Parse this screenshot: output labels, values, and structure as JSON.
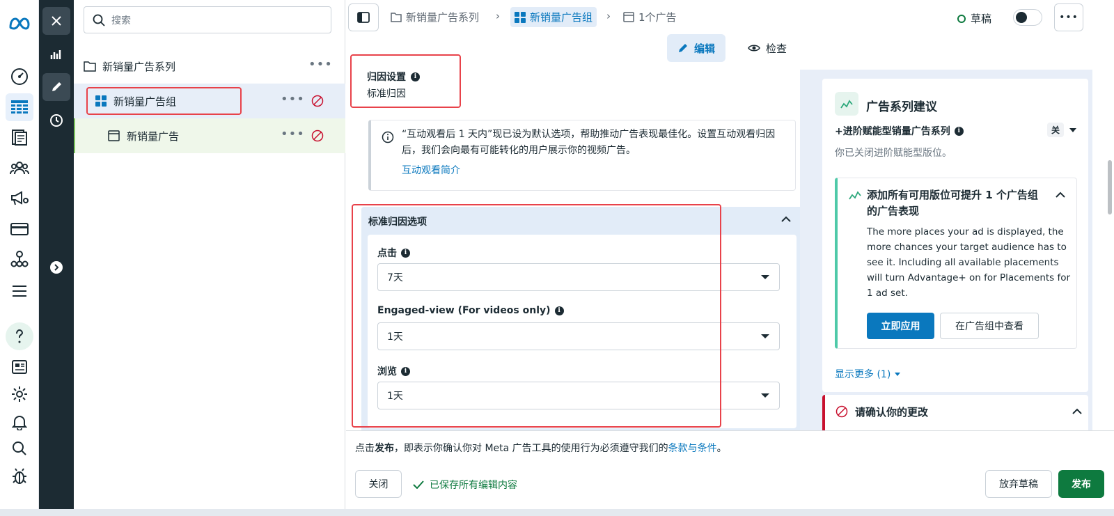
{
  "search": {
    "placeholder": "搜索"
  },
  "tree": {
    "campaign": {
      "label": "新销量广告系列"
    },
    "adset": {
      "label": "新销量广告组"
    },
    "ad": {
      "label": "新销量广告"
    },
    "more": "•••"
  },
  "breadcrumb": {
    "campaign": "新销量广告系列",
    "adset": "新销量广告组",
    "ad": "1个广告"
  },
  "status": {
    "label": "草稿"
  },
  "more_button": "•••",
  "mode_tabs": {
    "edit": "编辑",
    "review": "检查"
  },
  "attribution": {
    "title": "归因设置",
    "value": "标准归因",
    "notice": "“互动观看后 1 天内”现已设为默认选项，帮助推动广告表现最佳化。设置互动观看归因后，我们会向最有可能转化的用户展示你的视频广告。",
    "notice_link": "互动观看简介"
  },
  "standard_options": {
    "title": "标准归因选项",
    "click_label": "点击",
    "click_value": "7天",
    "engaged_label": "Engaged-view (For videos only)",
    "engaged_value": "1天",
    "view_label": "浏览",
    "view_value": "1天"
  },
  "recommendations": {
    "title": "广告系列建议",
    "advantage_label": "+进阶赋能型销量广告系列",
    "advantage_toggle": "关",
    "advantage_desc": "你已关闭进阶赋能型版位。",
    "card_title": "添加所有可用版位可提升 1 个广告组的广告表现",
    "card_body": "The more places your ad is displayed, the more chances your target audience has to see it. Including all available placements will turn Advantage+ on for Placements for 1 ad set.",
    "apply_btn": "立即应用",
    "view_btn": "在广告组中查看",
    "show_more": "显示更多 (1)",
    "confirm_title": "请确认你的更改"
  },
  "footer": {
    "terms_pre": "点击",
    "terms_bold": "发布",
    "terms_mid": "，即表示你确认你对 Meta 广告工具的使用行为必须遵守我们的",
    "terms_link": "条款与条件",
    "terms_end": "。",
    "close_btn": "关闭",
    "saved": "已保存所有编辑内容",
    "discard_btn": "放弃草稿",
    "publish_btn": "发布"
  },
  "colors": {
    "accent": "#0a78be",
    "publish": "#0e7a3f",
    "highlight": "#e8424a",
    "dark_rail": "#1c2b33"
  }
}
